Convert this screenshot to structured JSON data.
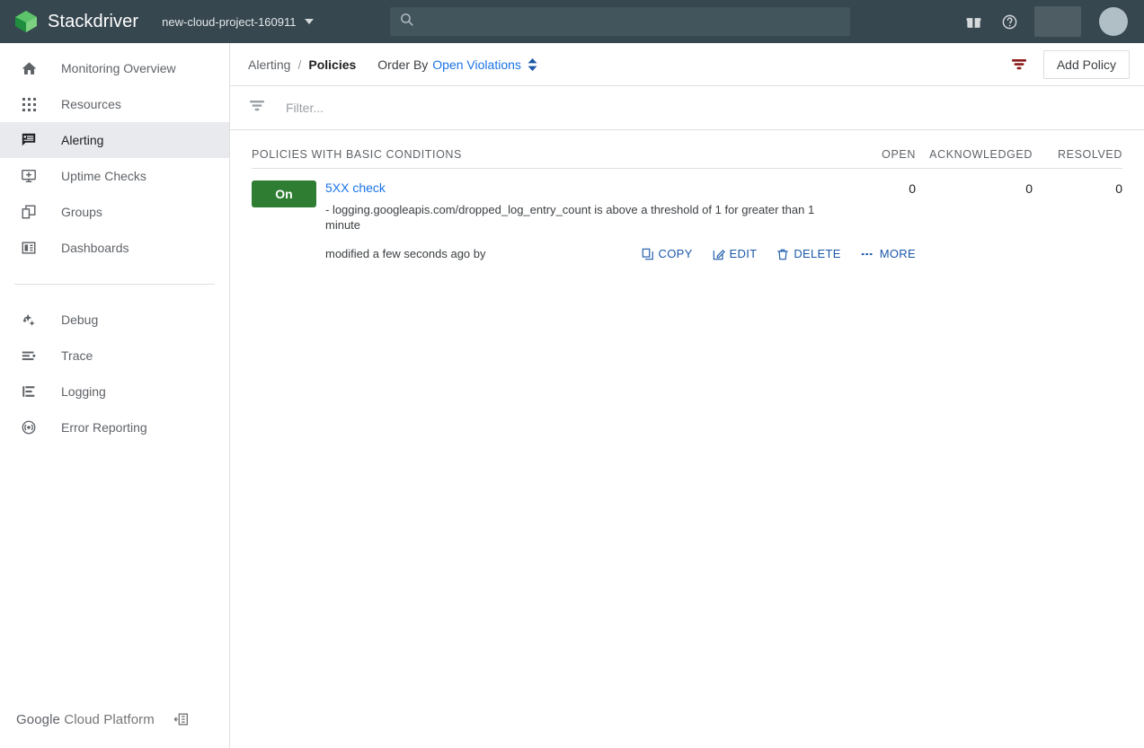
{
  "header": {
    "brand_name": "Stackdriver",
    "logo_icon": "stackdriver-cube-logo",
    "project_name": "new-cloud-project-160911",
    "project_caret_icon": "chevron-down-icon",
    "search": {
      "value": "",
      "placeholder": "",
      "icon": "search-icon"
    },
    "gift_icon": "gift-icon",
    "help_icon": "help-circle-icon",
    "account_placeholder": "",
    "avatar_icon": "avatar"
  },
  "sidebar": {
    "items_primary": [
      {
        "label": "Monitoring Overview",
        "icon": "home-icon",
        "active": false
      },
      {
        "label": "Resources",
        "icon": "grid-dots-icon",
        "active": false
      },
      {
        "label": "Alerting",
        "icon": "announcement-icon",
        "active": true
      },
      {
        "label": "Uptime Checks",
        "icon": "monitor-check-icon",
        "active": false
      },
      {
        "label": "Groups",
        "icon": "layers-icon",
        "active": false
      },
      {
        "label": "Dashboards",
        "icon": "dashboard-icon",
        "active": false
      }
    ],
    "items_secondary": [
      {
        "label": "Debug",
        "icon": "debug-icon",
        "active": false
      },
      {
        "label": "Trace",
        "icon": "trace-icon",
        "active": false
      },
      {
        "label": "Logging",
        "icon": "logging-icon",
        "active": false
      },
      {
        "label": "Error Reporting",
        "icon": "error-reporting-icon",
        "active": false
      }
    ],
    "footer": {
      "logo_google": "Google",
      "logo_rest": "Cloud Platform",
      "collapse_icon": "collapse-sidebar-icon"
    }
  },
  "toolbar": {
    "breadcrumb_parent": "Alerting",
    "breadcrumb_separator": "/",
    "breadcrumb_current": "Policies",
    "order_by_label": "Order By",
    "order_by_value": "Open Violations",
    "sort_icon": "sort-updown-icon",
    "filter_icon": "filter-active-icon",
    "add_policy_label": "Add Policy"
  },
  "filterbar": {
    "icon": "filter-icon",
    "value": "",
    "placeholder": "Filter..."
  },
  "table": {
    "section_title": "POLICIES WITH BASIC CONDITIONS",
    "columns": [
      "OPEN",
      "ACKNOWLEDGED",
      "RESOLVED"
    ],
    "rows": [
      {
        "state": "On",
        "name": "5XX check",
        "condition": "- logging.googleapis.com/dropped_log_entry_count is above a threshold of 1 for greater than 1 minute",
        "open": "0",
        "acknowledged": "0",
        "resolved": "0",
        "modified": "modified a few seconds ago by",
        "actions": [
          {
            "label": "COPY",
            "icon": "copy-icon"
          },
          {
            "label": "EDIT",
            "icon": "edit-pencil-icon"
          },
          {
            "label": "DELETE",
            "icon": "trash-icon"
          },
          {
            "label": "MORE",
            "icon": "more-dots-icon"
          }
        ]
      }
    ]
  },
  "colors": {
    "header_bg": "#37474f",
    "accent_link": "#1a73e8",
    "state_on_green": "#2e7d32",
    "filter_active_red": "#8b1a1a",
    "action_link": "#1a57a8"
  }
}
